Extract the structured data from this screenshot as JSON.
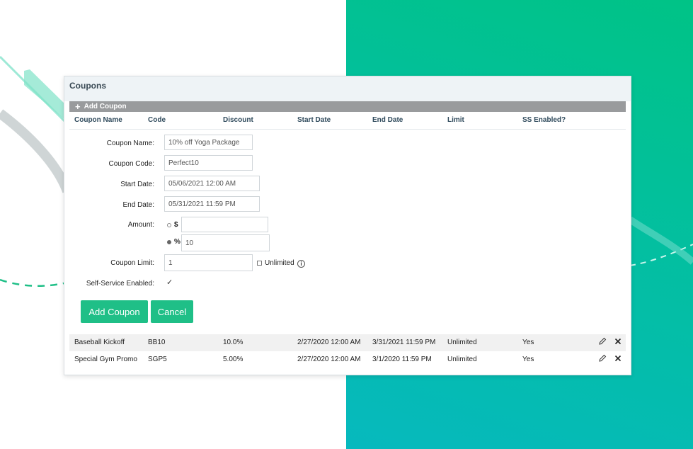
{
  "panel": {
    "title": "Coupons",
    "add_label": "Add Coupon"
  },
  "columns": [
    "Coupon Name",
    "Code",
    "Discount",
    "Start Date",
    "End Date",
    "Limit",
    "SS Enabled?"
  ],
  "form": {
    "coupon_name": {
      "label": "Coupon Name:",
      "value": "10% off Yoga Package"
    },
    "coupon_code": {
      "label": "Coupon Code:",
      "value": "Perfect10"
    },
    "start_date": {
      "label": "Start Date:",
      "value": "05/06/2021 12:00 AM"
    },
    "end_date": {
      "label": "End Date:",
      "value": "05/31/2021 11:59 PM"
    },
    "amount": {
      "label": "Amount:",
      "dollar_symbol": "$",
      "dollar_value": "",
      "percent_symbol": "%",
      "percent_value": "10",
      "selected": "percent"
    },
    "coupon_limit": {
      "label": "Coupon Limit:",
      "value": "1",
      "unlimited_label": "Unlimited",
      "unlimited_checked": false
    },
    "self_service": {
      "label": "Self-Service Enabled:",
      "checked": true,
      "check_mark": "✓"
    },
    "add_button": "Add Coupon",
    "cancel_button": "Cancel"
  },
  "rows": [
    {
      "name": "Baseball Kickoff",
      "code": "BB10",
      "discount": "10.0%",
      "start": "2/27/2020 12:00 AM",
      "end": "3/31/2021 11:59 PM",
      "limit": "Unlimited",
      "ss": "Yes"
    },
    {
      "name": "Special Gym Promo",
      "code": "SGP5",
      "discount": "5.00%",
      "start": "2/27/2020 12:00 AM",
      "end": "3/1/2020 11:59 PM",
      "limit": "Unlimited",
      "ss": "Yes"
    }
  ],
  "colors": {
    "accent": "#1fbf87",
    "teal_top": "#00c386",
    "teal_bottom": "#06b9be",
    "header_bar": "#999b9d"
  }
}
